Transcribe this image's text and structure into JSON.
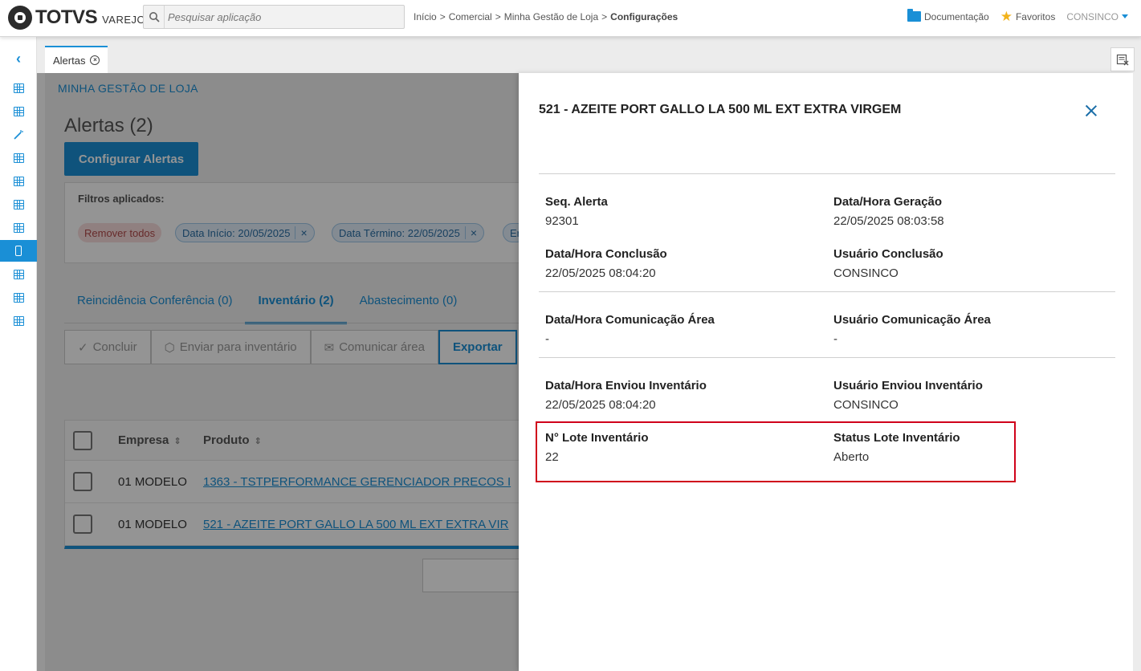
{
  "header": {
    "logo_text": "TOTVS",
    "logo_sub": "VAREJO",
    "search_placeholder": "Pesquisar aplicação",
    "breadcrumb": [
      "Início",
      "Comercial",
      "Minha Gestão de Loja",
      "Configurações"
    ],
    "documentation_label": "Documentação",
    "favorites_label": "Favoritos",
    "user_label": "CONSINCO",
    "colors": {
      "accent": "#1a8fd6",
      "star": "#f2b31c"
    }
  },
  "tabs": {
    "active_tab": "Alertas"
  },
  "main": {
    "section_title": "MINHA GESTÃO DE LOJA",
    "page_title": "Alertas (2)",
    "config_button": "Configurar Alertas",
    "filters": {
      "label": "Filtros aplicados:",
      "remove_all": "Remover todos",
      "chips": [
        "Data Início: 20/05/2025",
        "Data Término: 22/05/2025",
        "Er"
      ]
    },
    "subtabs": [
      "Reincidência Conferência (0)",
      "Inventário (2)",
      "Abastecimento (0)"
    ],
    "actions": [
      "Concluir",
      "Enviar para inventário",
      "Comunicar área",
      "Exportar"
    ],
    "table": {
      "headers": [
        "Empresa",
        "Produto"
      ],
      "rows": [
        {
          "empresa": "01 MODELO",
          "produto": "1363 - TSTPERFORMANCE GERENCIADOR PRECOS I"
        },
        {
          "empresa": "01 MODELO",
          "produto": "521 - AZEITE PORT GALLO LA 500 ML EXT EXTRA VIR"
        }
      ]
    }
  },
  "panel": {
    "title": "521 - AZEITE PORT GALLO LA 500 ML EXT EXTRA VIRGEM",
    "fields": {
      "seq_alerta": {
        "label": "Seq. Alerta",
        "value": "92301"
      },
      "data_geracao": {
        "label": "Data/Hora Geração",
        "value": "22/05/2025 08:03:58"
      },
      "data_conclusao": {
        "label": "Data/Hora Conclusão",
        "value": "22/05/2025 08:04:20"
      },
      "usuario_conclusao": {
        "label": "Usuário Conclusão",
        "value": "CONSINCO"
      },
      "data_comunicacao": {
        "label": "Data/Hora Comunicação Área",
        "value": "-"
      },
      "usuario_comunicacao": {
        "label": "Usuário Comunicação Área",
        "value": "-"
      },
      "data_enviou": {
        "label": "Data/Hora Enviou Inventário",
        "value": "22/05/2025 08:04:20"
      },
      "usuario_enviou": {
        "label": "Usuário Enviou Inventário",
        "value": "CONSINCO"
      },
      "lote": {
        "label": "N° Lote Inventário",
        "value": "22"
      },
      "status_lote": {
        "label": "Status Lote Inventário",
        "value": "Aberto"
      }
    },
    "highlight_color": "#d0021b"
  }
}
